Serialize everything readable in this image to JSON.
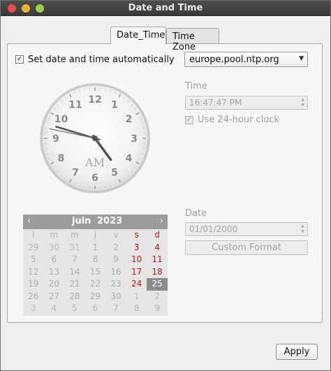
{
  "window": {
    "title": "Date and Time"
  },
  "tabs": [
    {
      "label": "Date_Time",
      "active": true
    },
    {
      "label": "Time Zone",
      "active": false
    }
  ],
  "auto": {
    "label": "Set date and time automatically",
    "checked": true,
    "checkmark": "✓"
  },
  "ntp_server": {
    "value": "europe.pool.ntp.org"
  },
  "clock": {
    "numbers": [
      "12",
      "1",
      "2",
      "3",
      "4",
      "5",
      "6",
      "7",
      "8",
      "9",
      "10",
      "11"
    ],
    "period": "AM",
    "hour": 4,
    "minute": 47,
    "second": 47
  },
  "time": {
    "label": "Time",
    "value": "16:47:47 PM"
  },
  "use24": {
    "label": "Use 24-hour clock",
    "checked": true,
    "checkmark": "✓"
  },
  "calendar": {
    "month": "juin",
    "year": "2023",
    "prev": "‹",
    "next": "›",
    "weekdays": [
      "l",
      "m",
      "m",
      "j",
      "v",
      "s",
      "d"
    ],
    "weeks": [
      [
        "29",
        "30",
        "31",
        "1",
        "2",
        "3",
        "4"
      ],
      [
        "5",
        "6",
        "7",
        "8",
        "9",
        "10",
        "11"
      ],
      [
        "12",
        "13",
        "14",
        "15",
        "16",
        "17",
        "18"
      ],
      [
        "19",
        "20",
        "21",
        "22",
        "23",
        "24",
        "25"
      ],
      [
        "26",
        "27",
        "28",
        "29",
        "30",
        "1",
        "2"
      ],
      [
        "3",
        "4",
        "5",
        "6",
        "7",
        "8",
        "9"
      ]
    ],
    "selected": "25"
  },
  "date": {
    "label": "Date",
    "value": "01/01/2000",
    "custom_format_label": "Custom Format"
  },
  "apply": {
    "label": "Apply"
  },
  "colors": {
    "weekend": "#c81515",
    "calendar_header": "#9c9c9c",
    "selected_day": "#8c8c8c"
  }
}
